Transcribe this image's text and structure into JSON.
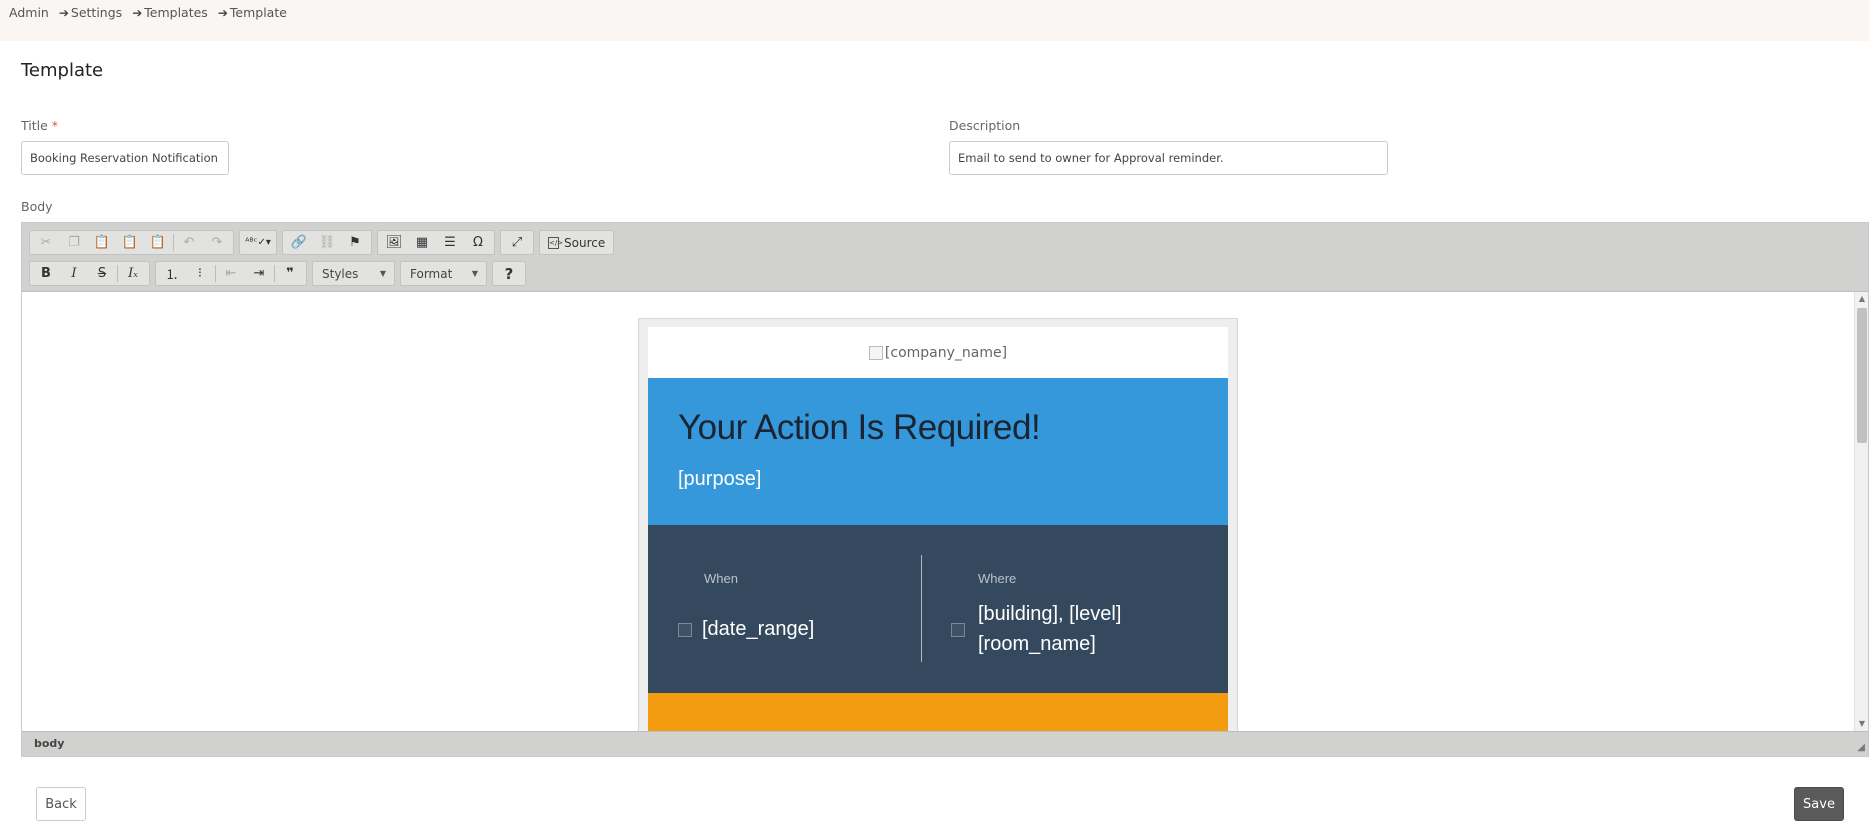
{
  "breadcrumb": {
    "items": [
      "Admin",
      "Settings",
      "Templates",
      "Template"
    ]
  },
  "page": {
    "title": "Template"
  },
  "form": {
    "title_label": "Title",
    "title_required_mark": "*",
    "title_value": "Booking Reservation Notification",
    "description_label": "Description",
    "description_value": "Email to send to  owner for Approval reminder.",
    "body_label": "Body"
  },
  "editor": {
    "toolbar_row1": [
      "cut-icon",
      "copy-icon",
      "paste-icon",
      "paste-text-icon",
      "paste-word-icon",
      "undo-icon",
      "redo-icon",
      "spellcheck-icon",
      "link-icon",
      "unlink-icon",
      "anchor-icon",
      "image-icon",
      "table-icon",
      "horizontal-rule-icon",
      "special-char-icon",
      "maximize-icon"
    ],
    "source_label": "Source",
    "toolbar_row2": [
      "bold-icon",
      "italic-icon",
      "strike-icon",
      "remove-format-icon",
      "numbered-list-icon",
      "bulleted-list-icon",
      "outdent-icon",
      "indent-icon",
      "blockquote-icon"
    ],
    "styles_label": "Styles",
    "format_label": "Format",
    "help_label": "?",
    "status_path": "body"
  },
  "email": {
    "logo_alt": "[company_name]",
    "heading": "Your Action Is Required!",
    "purpose": "[purpose]",
    "when_label": "When",
    "when_value": "[date_range]",
    "where_label": "Where",
    "where_value_line1": "[building], [level]",
    "where_value_line2": "[room_name]",
    "colors": {
      "blue": "#3498db",
      "dark": "#34495e",
      "orange": "#f39c12"
    }
  },
  "actions": {
    "back_label": "Back",
    "save_label": "Save"
  }
}
